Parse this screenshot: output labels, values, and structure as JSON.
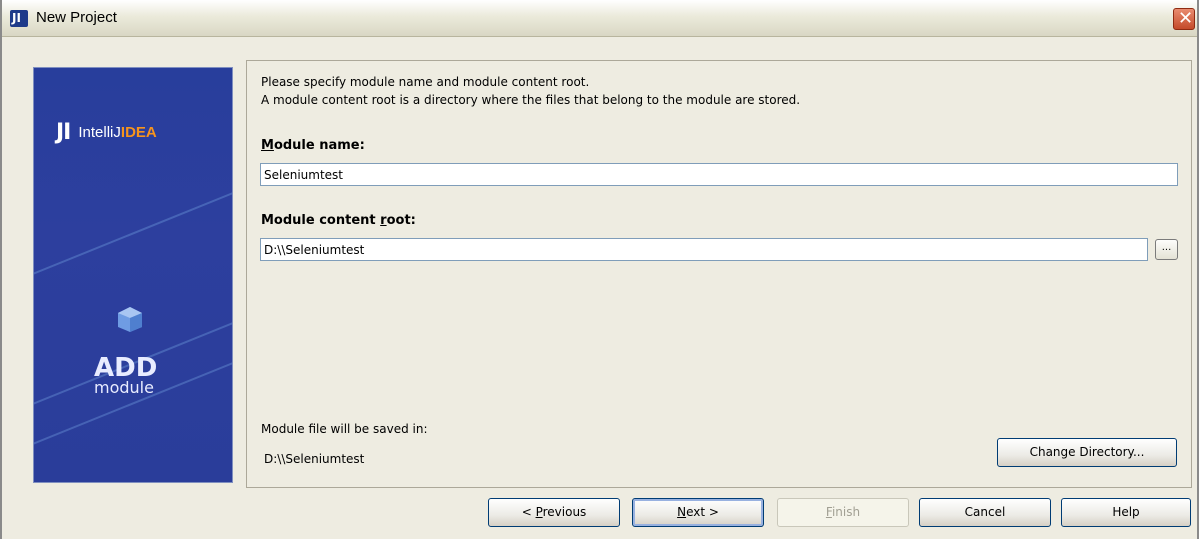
{
  "window": {
    "title": "New Project",
    "close_glyph": "✕"
  },
  "banner": {
    "brand_mark": "JI",
    "brand_name_plain": "IntelliJ",
    "brand_name_accent": "IDEA",
    "add_label": "ADD",
    "module_label": "module",
    "accent_color": "#f7941d"
  },
  "content": {
    "description_line1": "Please specify module name and module content root.",
    "description_line2": "A module content root is a directory where the files that belong to the module are stored.",
    "module_name_label_mnemonic": "M",
    "module_name_label_rest": "odule name:",
    "module_name_value": "Seleniumtest",
    "content_root_label_prefix": "Module content ",
    "content_root_label_mnemonic": "r",
    "content_root_label_suffix": "oot:",
    "content_root_value": "D:\\\\Seleniumtest",
    "browse_label": "...",
    "saved_in_label": "Module file will be saved in:",
    "saved_in_path": "D:\\\\Seleniumtest",
    "change_directory_label": "Change Directory..."
  },
  "buttons": {
    "previous_prefix": "< ",
    "previous_mnemonic": "P",
    "previous_rest": "revious",
    "next_mnemonic": "N",
    "next_rest": "ext >",
    "finish_mnemonic": "F",
    "finish_rest": "inish",
    "cancel": "Cancel",
    "help": "Help"
  }
}
